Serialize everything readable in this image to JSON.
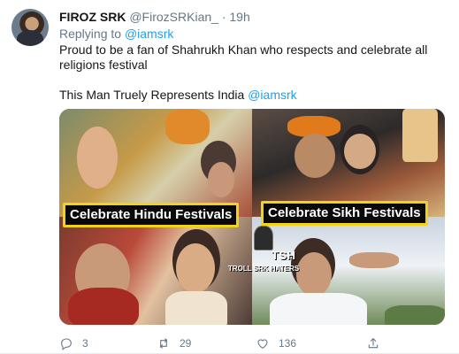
{
  "tweet": {
    "author_name": "FIROZ SRK",
    "author_handle": "@FirozSRKian_",
    "separator": "·",
    "time": "19h",
    "replying_prefix": "Replying to",
    "replying_to": "@iamsrk",
    "text_line1": "Proud to be a fan of Shahrukh Khan who respects and celebrate all religions festival",
    "text_line2_prefix": "This Man Truely Represents India",
    "text_line2_mention": "@iamsrk"
  },
  "media": {
    "captions": [
      "Celebrate Hindu Festivals",
      "Celebrate Sikh Festivals"
    ],
    "watermark_big": "TSH",
    "watermark_small": "TROLL SRK HATERS"
  },
  "actions": {
    "reply_count": "3",
    "retweet_count": "29",
    "like_count": "136",
    "icons": [
      "reply-icon",
      "retweet-icon",
      "like-icon",
      "share-icon"
    ]
  },
  "colors": {
    "link": "#1da1f2",
    "secondary_text": "#657786",
    "caption_border": "#f2d31b"
  }
}
